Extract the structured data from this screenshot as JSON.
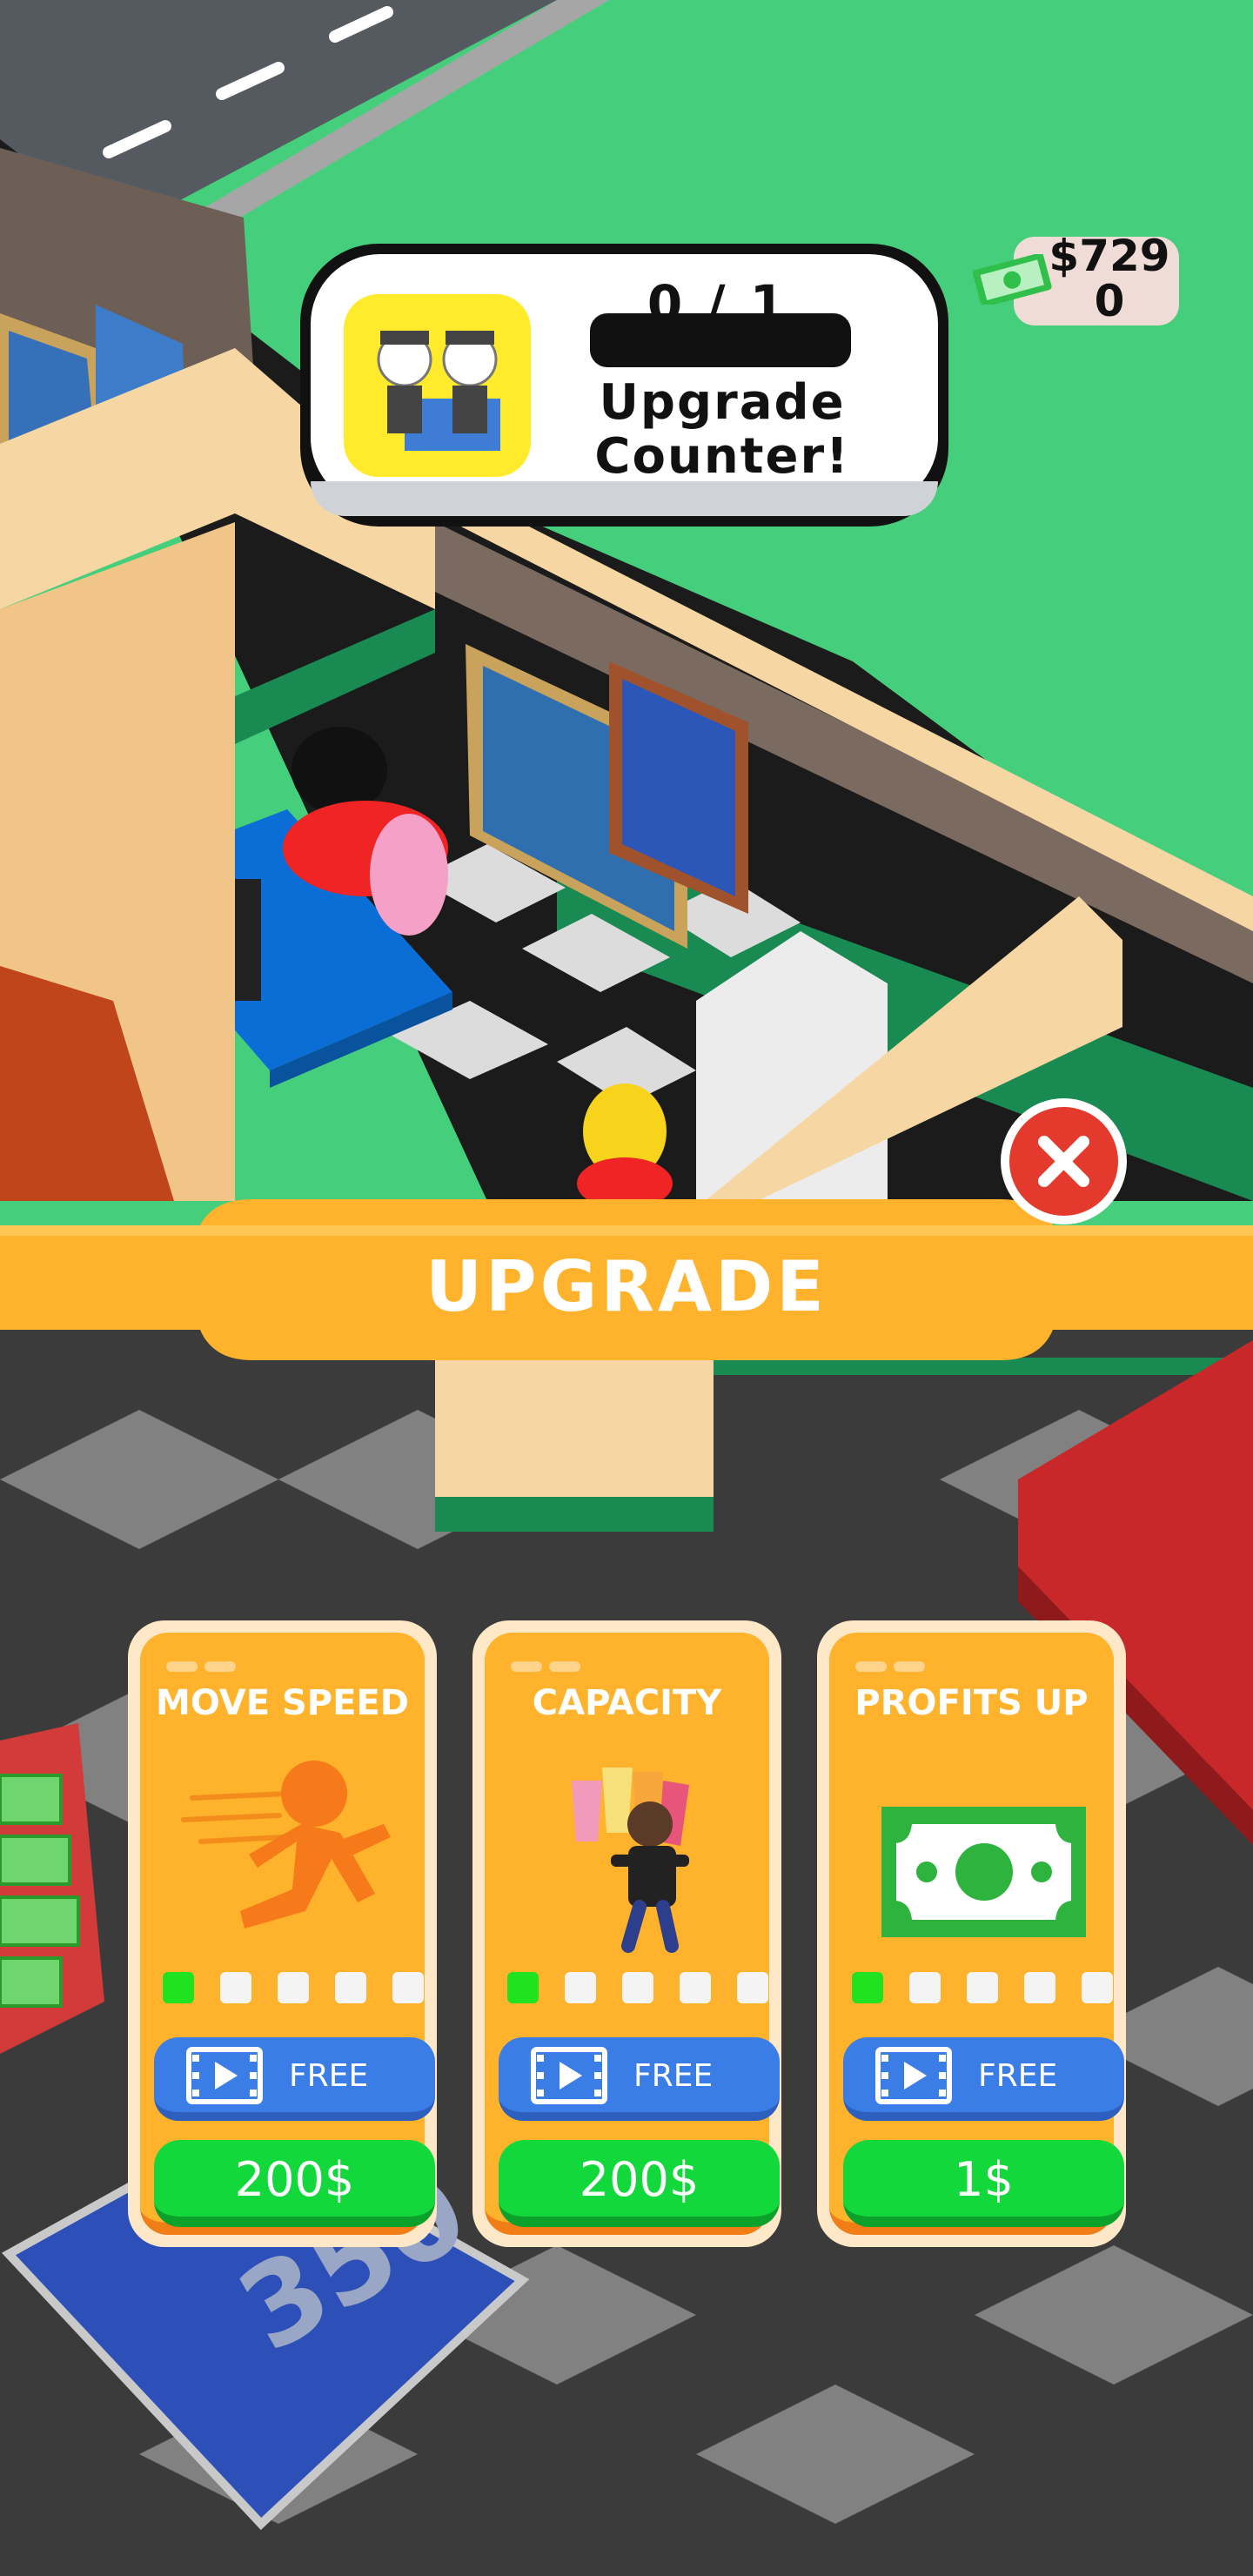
{
  "quest": {
    "progress": "0 / 1",
    "progress_fraction": 0,
    "title": "Upgrade Counter!"
  },
  "money": {
    "amount": "$729\n0"
  },
  "banner": {
    "title": "UPGRADE"
  },
  "floor_price": "350",
  "cards": [
    {
      "title": "MOVE SPEED",
      "level": 1,
      "max_level": 5,
      "free_label": "FREE",
      "price": "200$",
      "icon": "running-figure-icon"
    },
    {
      "title": "CAPACITY",
      "level": 1,
      "max_level": 5,
      "free_label": "FREE",
      "price": "200$",
      "icon": "carrying-drinks-icon"
    },
    {
      "title": "PROFITS UP",
      "level": 1,
      "max_level": 5,
      "free_label": "FREE",
      "price": "1$",
      "icon": "cash-bill-icon"
    }
  ],
  "colors": {
    "banner": "#ffb22b",
    "card": "#ffb22b",
    "free_button": "#3a7de6",
    "buy_button": "#13d83c",
    "level_on": "#1ee31e",
    "close_button": "#e43a2d"
  }
}
